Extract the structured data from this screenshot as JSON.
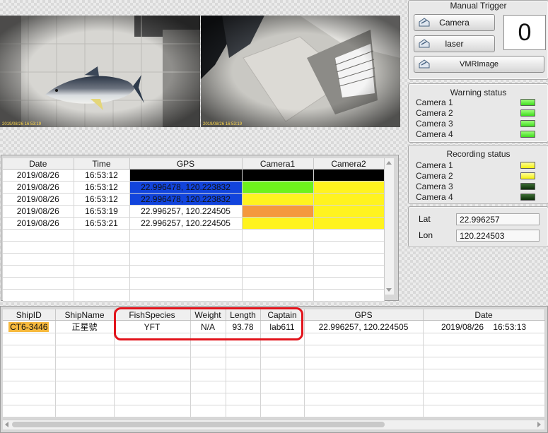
{
  "cameras": {
    "cam1_timestamp": "2019/08/26  16:53:19",
    "cam2_timestamp": "2019/08/26  16:53:19"
  },
  "manual_trigger": {
    "title": "Manual Trigger",
    "camera_label": "Camera",
    "laser_label": "laser",
    "vmrimage_label": "VMRImage",
    "counter": "0"
  },
  "warning_status": {
    "title": "Warning status",
    "items": [
      {
        "label": "Camera 1",
        "color": "#4be12a"
      },
      {
        "label": "Camera 2",
        "color": "#4be12a"
      },
      {
        "label": "Camera 3",
        "color": "#4be12a"
      },
      {
        "label": "Camera 4",
        "color": "#4be12a"
      }
    ]
  },
  "recording_status": {
    "title": "Recording status",
    "items": [
      {
        "label": "Camera 1",
        "color": "#f4f00f"
      },
      {
        "label": "Camera 2",
        "color": "#f4f00f"
      },
      {
        "label": "Camera 3",
        "color": "#123a0e"
      },
      {
        "label": "Camera 4",
        "color": "#123a0e"
      }
    ]
  },
  "location": {
    "lat_label": "Lat",
    "lat_value": "22.996257",
    "lon_label": "Lon",
    "lon_value": "120.224503"
  },
  "event_table": {
    "headers": [
      "Date",
      "Time",
      "GPS",
      "Camera1",
      "Camera2"
    ],
    "rows": [
      {
        "date": "2019/08/26",
        "time": "16:53:12",
        "gps": "",
        "gps_color": "#000000",
        "cam1_color": "#000000",
        "cam2_color": "#000000"
      },
      {
        "date": "2019/08/26",
        "time": "16:53:12",
        "gps": "22.996478, 120.223832",
        "gps_color": "#1244dc",
        "cam1_color": "#6ef21c",
        "cam2_color": "#fff31f"
      },
      {
        "date": "2019/08/26",
        "time": "16:53:12",
        "gps": "22.996478, 120.223832",
        "gps_color": "#1244dc",
        "cam1_color": "#fff31f",
        "cam2_color": "#fff31f"
      },
      {
        "date": "2019/08/26",
        "time": "16:53:19",
        "gps": "22.996257, 120.224505",
        "gps_color": "#ffffff",
        "cam1_color": "#f4993e",
        "cam2_color": "#fff31f"
      },
      {
        "date": "2019/08/26",
        "time": "16:53:21",
        "gps": "22.996257, 120.224505",
        "gps_color": "#ffffff",
        "cam1_color": "#fff31f",
        "cam2_color": "#fff31f"
      }
    ]
  },
  "catch_table": {
    "headers": [
      "ShipID",
      "ShipName",
      "FishSpecies",
      "Weight",
      "Length",
      "Captain",
      "GPS",
      "Date"
    ],
    "rows": [
      {
        "ship_id": "CT6-3446",
        "ship_name": "正星號",
        "fish_species": "YFT",
        "weight": "N/A",
        "length": "93.78",
        "captain": "lab611",
        "gps": "22.996257, 120.224505",
        "date": "2019/08/26    16:53:13"
      }
    ],
    "highlight_color": "#e2131b"
  }
}
